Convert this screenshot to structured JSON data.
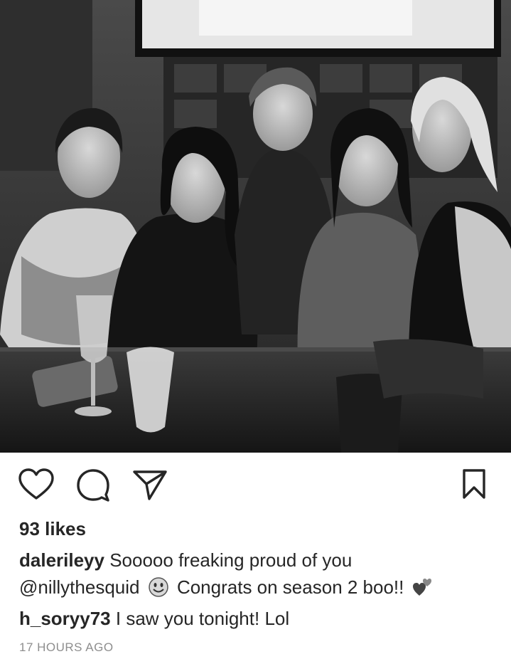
{
  "post": {
    "image_alt": "",
    "likes": "93 likes",
    "caption": {
      "username": "dalerileyy",
      "text_part1": " Sooooo freaking proud of you",
      "mention": "@nillythesquid",
      "text_part2": " Congrats on season 2 boo!!",
      "emoji_1": "smiling-face-emoji",
      "emoji_2": "two-hearts-emoji"
    },
    "comment": {
      "username": "h_soryy73",
      "text": " I saw you tonight! Lol"
    },
    "timestamp": "17 HOURS AGO"
  },
  "icons": {
    "like": "heart-icon",
    "comment": "comment-icon",
    "share": "send-icon",
    "save": "bookmark-icon"
  },
  "colors": {
    "text": "#262626",
    "muted": "#8e8e8e",
    "background": "#ffffff"
  }
}
